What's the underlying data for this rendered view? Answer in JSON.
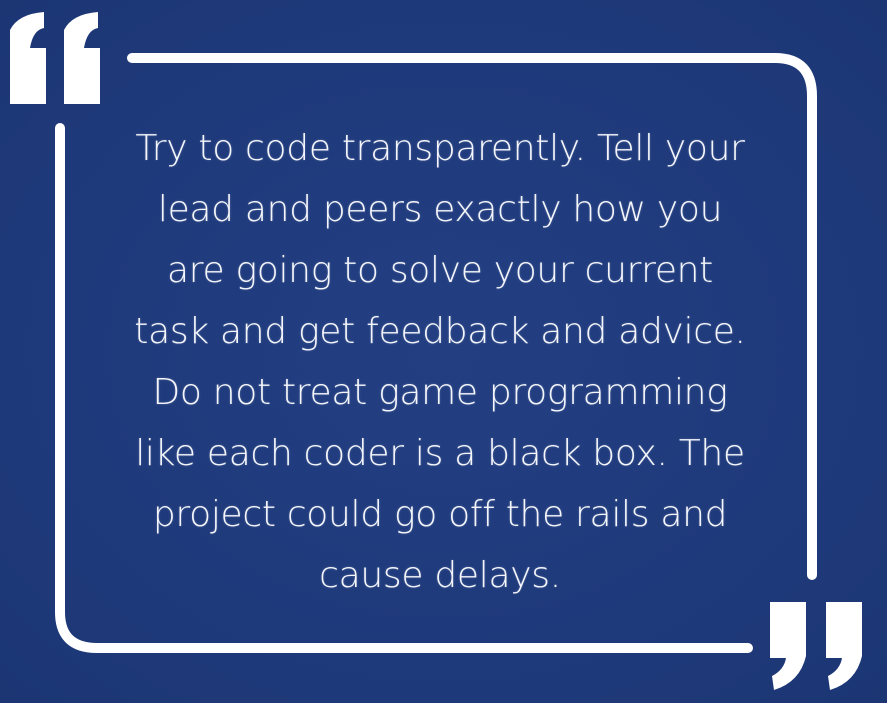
{
  "quote": {
    "lines": [
      "Try to code transparently. Tell your",
      "lead and peers exactly how you",
      "are going to solve your current",
      "task and get feedback and advice.",
      "Do not treat game programming",
      "like each coder is a black box. The",
      "project could go off the rails and",
      "cause delays."
    ]
  },
  "icons": {
    "open_quote": "open-quote-mark-icon",
    "close_quote": "close-quote-mark-icon"
  },
  "colors": {
    "background": "#1f3a7b",
    "foreground": "#ffffff"
  }
}
